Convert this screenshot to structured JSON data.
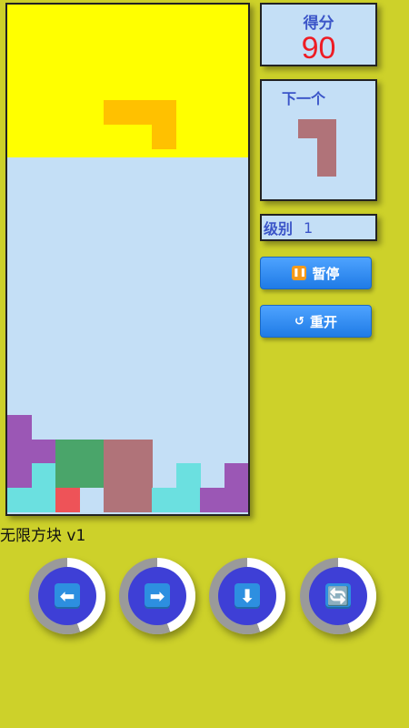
{
  "score": {
    "label": "得分",
    "value": "90"
  },
  "next": {
    "label": "下一个",
    "piece_color": "#b07379"
  },
  "level": {
    "label": "级别",
    "value": "1"
  },
  "buttons": {
    "pause": "暂停",
    "restart": "重开"
  },
  "app_title": "无限方块 v1",
  "controls": [
    {
      "name": "move-left",
      "icon": "left-arrow-icon",
      "glyph": "⬅"
    },
    {
      "name": "move-right",
      "icon": "right-arrow-icon",
      "glyph": "➡"
    },
    {
      "name": "drop-down",
      "icon": "down-arrow-icon",
      "glyph": "⬇"
    },
    {
      "name": "rotate",
      "icon": "rotate-icon",
      "glyph": "🔄"
    }
  ],
  "colors": {
    "background": "#cdd12a",
    "board": "#c4dff6",
    "danger_zone": "#ffff00",
    "falling_piece": "#ffc100",
    "purple": "#9b57b5",
    "cyan": "#6be0e0",
    "green": "#4aa56a",
    "mauve": "#b07379",
    "red": "#ee5358"
  },
  "falling_piece": {
    "color": "#ffc100",
    "cells": [
      [
        4,
        4
      ],
      [
        5,
        4
      ],
      [
        6,
        4
      ],
      [
        6,
        5
      ]
    ]
  },
  "next_piece_cells": [
    [
      0,
      0
    ],
    [
      1,
      0
    ],
    [
      1,
      1
    ],
    [
      1,
      2
    ]
  ],
  "settled_cells": [
    {
      "c": 0,
      "r": 17,
      "color": "#9b57b5"
    },
    {
      "c": 0,
      "r": 18,
      "color": "#9b57b5"
    },
    {
      "c": 1,
      "r": 18,
      "color": "#9b57b5"
    },
    {
      "c": 0,
      "r": 19,
      "color": "#9b57b5"
    },
    {
      "c": 1,
      "r": 19,
      "color": "#6be0e0"
    },
    {
      "c": 0,
      "r": 20,
      "color": "#6be0e0"
    },
    {
      "c": 1,
      "r": 20,
      "color": "#6be0e0"
    },
    {
      "c": 2,
      "r": 20,
      "color": "#ee5358"
    },
    {
      "c": 2,
      "r": 18,
      "color": "#4aa56a"
    },
    {
      "c": 3,
      "r": 18,
      "color": "#4aa56a"
    },
    {
      "c": 2,
      "r": 19,
      "color": "#4aa56a"
    },
    {
      "c": 3,
      "r": 19,
      "color": "#4aa56a"
    },
    {
      "c": 4,
      "r": 18,
      "color": "#b07379"
    },
    {
      "c": 5,
      "r": 18,
      "color": "#b07379"
    },
    {
      "c": 4,
      "r": 19,
      "color": "#b07379"
    },
    {
      "c": 5,
      "r": 19,
      "color": "#b07379"
    },
    {
      "c": 4,
      "r": 20,
      "color": "#b07379"
    },
    {
      "c": 5,
      "r": 20,
      "color": "#b07379"
    },
    {
      "c": 6,
      "r": 20,
      "color": "#6be0e0"
    },
    {
      "c": 7,
      "r": 20,
      "color": "#6be0e0"
    },
    {
      "c": 7,
      "r": 19,
      "color": "#6be0e0"
    },
    {
      "c": 8,
      "r": 20,
      "color": "#9b57b5"
    },
    {
      "c": 9,
      "r": 20,
      "color": "#9b57b5"
    },
    {
      "c": 9,
      "r": 19,
      "color": "#9b57b5"
    }
  ]
}
